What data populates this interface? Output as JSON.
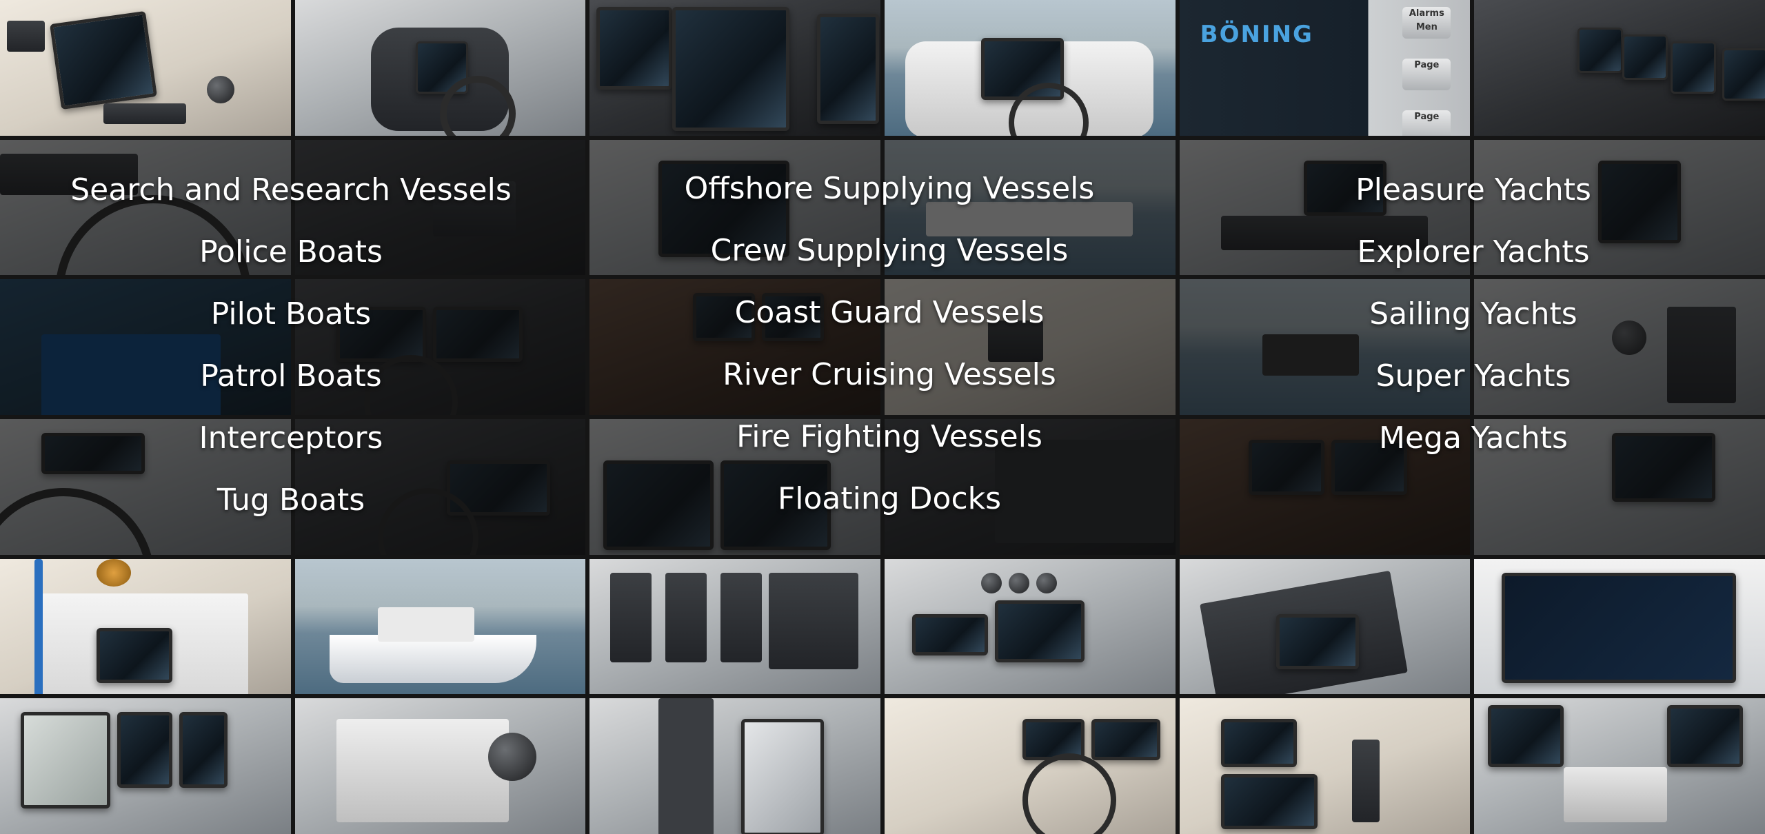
{
  "brand_text": "BÖNING",
  "side_keys": [
    "Alarms Men",
    "Page",
    "Page"
  ],
  "categories": {
    "left": [
      "Search and Research Vessels",
      "Police Boats",
      "Pilot Boats",
      "Patrol Boats",
      "Interceptors",
      "Tug Boats"
    ],
    "center": [
      "Offshore Supplying Vessels",
      "Crew Supplying Vessels",
      "Coast Guard Vessels",
      "River Cruising Vessels",
      "Fire Fighting Vessels",
      "Floating Docks"
    ],
    "right": [
      "Pleasure Yachts",
      "Explorer Yachts",
      "Sailing Yachts",
      "Super Yachts",
      "Mega Yachts"
    ]
  }
}
